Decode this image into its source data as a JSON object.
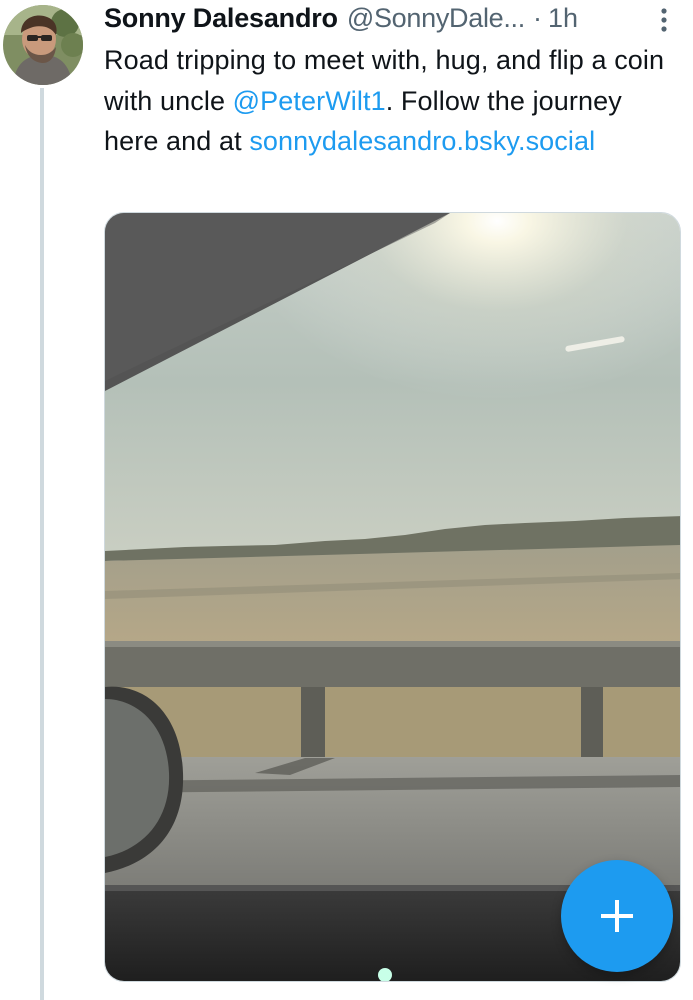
{
  "tweet": {
    "author": {
      "display_name": "Sonny Dalesandro",
      "handle": "@SonnyDale...",
      "avatar_icon": "profile-photo-avatar"
    },
    "separator": "·",
    "time": "1h",
    "text": {
      "line_part_1": "Road tripping to meet with, hug, and flip a coin with uncle ",
      "mention": "@PeterWilt1",
      "line_part_2": ". Follow the journey here and at ",
      "link": "sonnydalesandro.bsky.social"
    },
    "more_icon": "vertical-ellipsis-icon",
    "media": {
      "kind": "photo",
      "description_icon": "highway-landscape-photo"
    }
  },
  "fab": {
    "icon": "plus-icon"
  },
  "colors": {
    "text_primary": "#0f1419",
    "text_secondary": "#536471",
    "accent": "#1d9bf0",
    "thread_line": "#cfd9de"
  }
}
